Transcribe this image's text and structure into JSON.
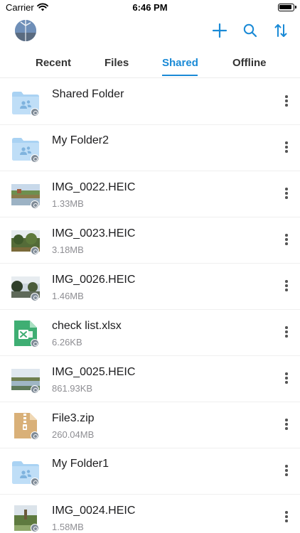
{
  "status_bar": {
    "carrier": "Carrier",
    "time": "6:46 PM"
  },
  "toolbar": {
    "icons": [
      "add-icon",
      "search-icon",
      "sort-icon"
    ],
    "accent": "#1a8ad6"
  },
  "tabs": [
    {
      "label": "Recent",
      "active": false
    },
    {
      "label": "Files",
      "active": false
    },
    {
      "label": "Shared",
      "active": true
    },
    {
      "label": "Offline",
      "active": false
    }
  ],
  "files": [
    {
      "name": "Shared Folder",
      "size": "",
      "kind": "folder"
    },
    {
      "name": "My Folder2",
      "size": "",
      "kind": "folder"
    },
    {
      "name": "IMG_0022.HEIC",
      "size": "1.33MB",
      "kind": "image"
    },
    {
      "name": "IMG_0023.HEIC",
      "size": "3.18MB",
      "kind": "image"
    },
    {
      "name": "IMG_0026.HEIC",
      "size": "1.46MB",
      "kind": "image"
    },
    {
      "name": "check list.xlsx",
      "size": "6.26KB",
      "kind": "spreadsheet"
    },
    {
      "name": "IMG_0025.HEIC",
      "size": "861.93KB",
      "kind": "image"
    },
    {
      "name": "File3.zip",
      "size": "260.04MB",
      "kind": "archive"
    },
    {
      "name": "My Folder1",
      "size": "",
      "kind": "folder"
    },
    {
      "name": "IMG_0024.HEIC",
      "size": "1.58MB",
      "kind": "image"
    }
  ]
}
